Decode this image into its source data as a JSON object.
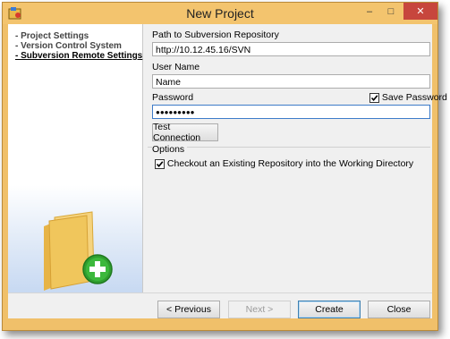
{
  "window": {
    "title": "New Project",
    "controls": {
      "minimize": "–",
      "maximize": "□",
      "close": "✕"
    }
  },
  "nav": {
    "items": [
      {
        "label": "- Project Settings",
        "active": false
      },
      {
        "label": "- Version Control System",
        "active": false
      },
      {
        "label": "- Subversion Remote Settings",
        "active": true
      }
    ]
  },
  "form": {
    "path_label": "Path to Subversion Repository",
    "path_value": "http://10.12.45.16/SVN",
    "user_label": "User Name",
    "user_value": "Name",
    "password_label": "Password",
    "password_value": "●●●●●●●●●",
    "save_password_label": "Save Password",
    "save_password_checked": true,
    "test_connection_label": "Test Connection",
    "options_label": "Options",
    "checkout_label": "Checkout an Existing Repository into the Working Directory",
    "checkout_checked": true
  },
  "buttons": {
    "previous": "< Previous",
    "next": "Next >",
    "create": "Create",
    "close": "Close"
  },
  "colors": {
    "titlebar": "#f3c46e",
    "close_button": "#c7463d",
    "focus_border": "#3d7bc9",
    "plus_badge": "#2f9e2f"
  }
}
